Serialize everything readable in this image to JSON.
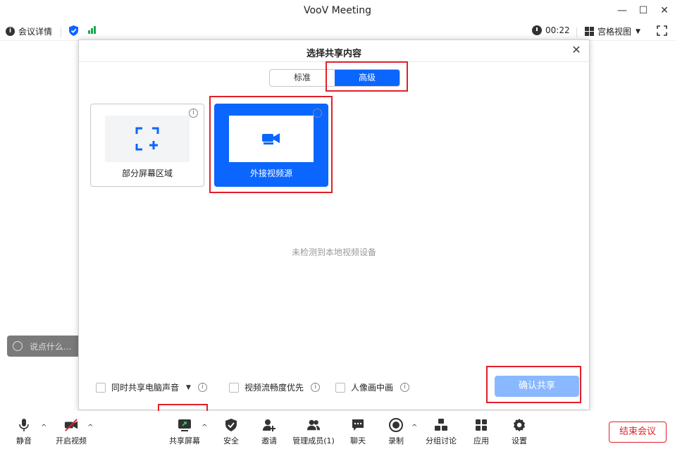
{
  "window": {
    "title": "VooV Meeting",
    "minimize": "—",
    "maximize": "☐",
    "close": "✕"
  },
  "infobar": {
    "meeting_details": "会议详情",
    "timer": "00:22",
    "view_mode": "宫格视图"
  },
  "chat": {
    "placeholder": "说点什么..."
  },
  "modal": {
    "title": "选择共享内容",
    "close": "✕",
    "tabs": [
      {
        "label": "标准"
      },
      {
        "label": "高级"
      }
    ],
    "cards": [
      {
        "label": "部分屏幕区域"
      },
      {
        "label": "外接视频源"
      }
    ],
    "empty_text": "未检测到本地视频设备",
    "options": [
      {
        "label": "同时共享电脑声音"
      },
      {
        "label": "视频流畅度优先"
      },
      {
        "label": "人像画中画"
      }
    ],
    "confirm_label": "确认共享"
  },
  "toolbar": {
    "items": [
      {
        "label": "静音"
      },
      {
        "label": "开启视频"
      },
      {
        "label": "共享屏幕"
      },
      {
        "label": "安全"
      },
      {
        "label": "邀请"
      },
      {
        "label": "管理成员(1)"
      },
      {
        "label": "聊天"
      },
      {
        "label": "录制"
      },
      {
        "label": "分组讨论"
      },
      {
        "label": "应用"
      },
      {
        "label": "设置"
      }
    ],
    "end_label": "结束会议"
  },
  "colors": {
    "accent": "#0a66ff",
    "highlight": "#e0202a",
    "signal": "#1ba84b",
    "disabled_button": "#8ab8ff"
  }
}
